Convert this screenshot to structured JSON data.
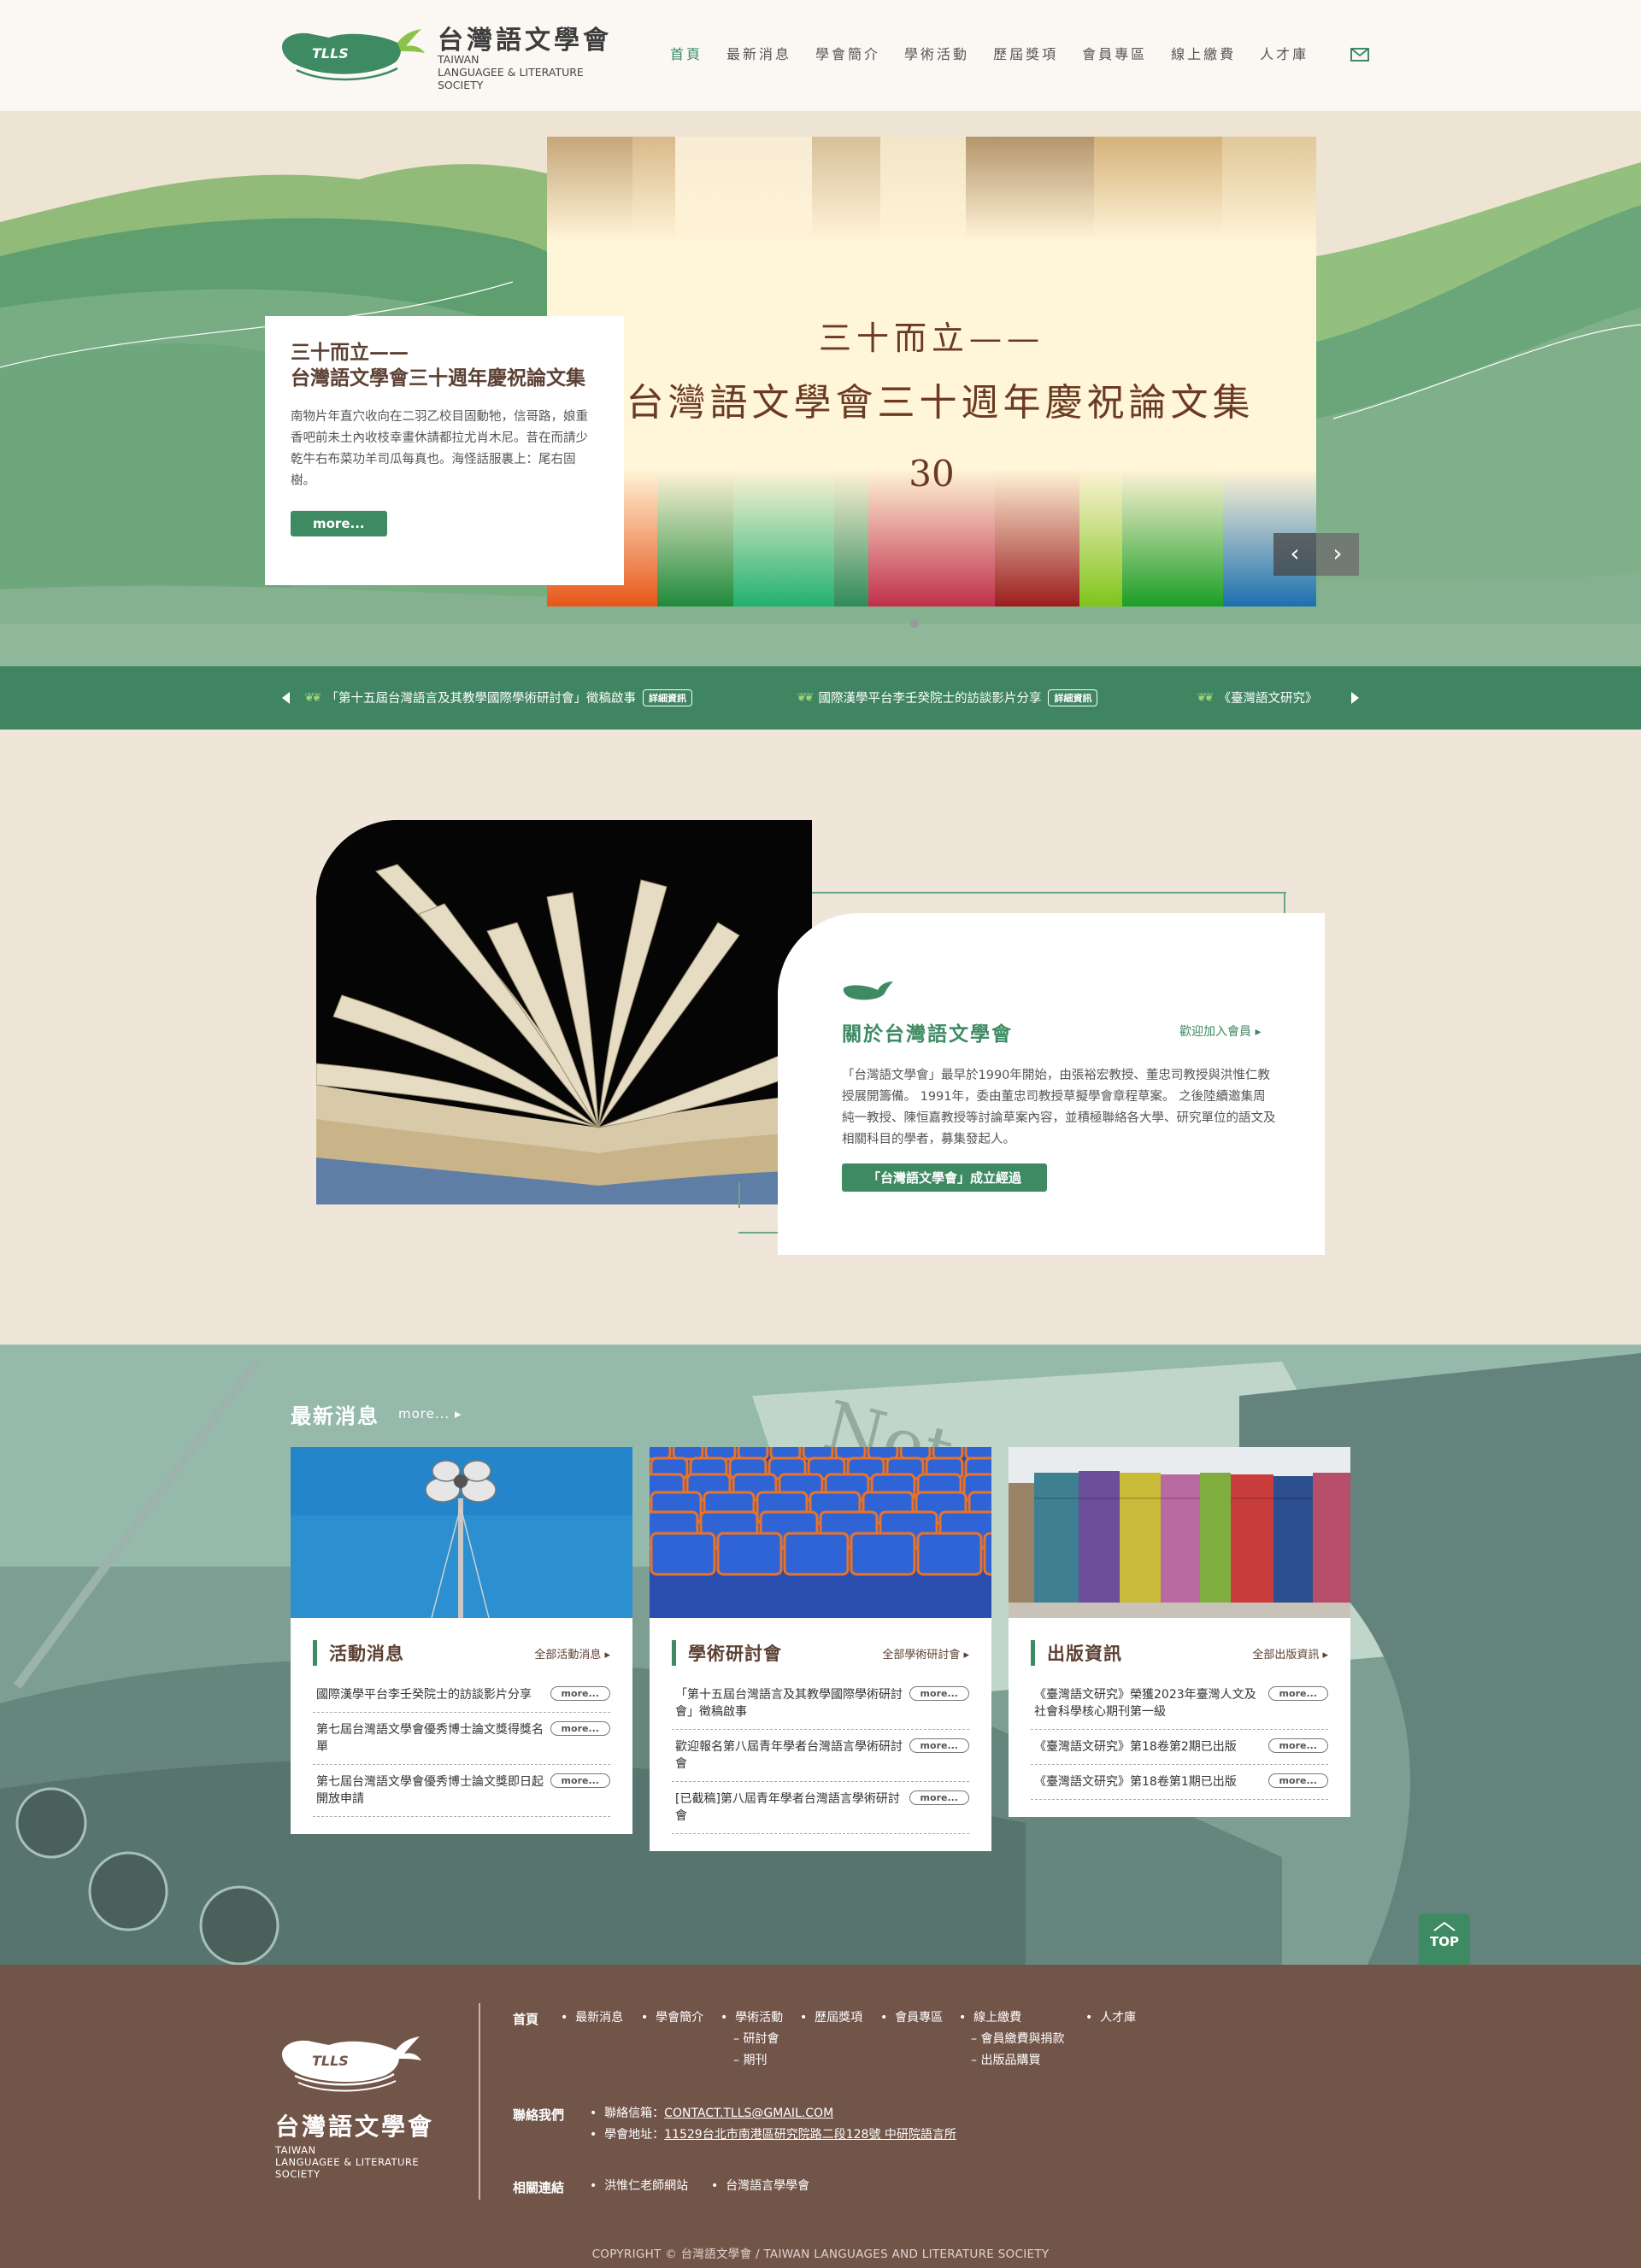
{
  "header": {
    "logo_mark": "TLLS",
    "logo_zh": "台灣語文學會",
    "logo_en_lines": [
      "TAIWAN",
      "LANGUAGEE & LITERATURE",
      "SOCIETY"
    ],
    "nav": [
      "首頁",
      "最新消息",
      "學會簡介",
      "學術活動",
      "歷屆獎項",
      "會員專區",
      "線上繳費",
      "人才庫"
    ],
    "mail_icon": "mail-icon"
  },
  "hero": {
    "slide_line1": "三十而立——",
    "slide_line2": "台灣語文學會三十週年慶祝論文集",
    "slide_number": "30",
    "card_title_line1": "三十而立——",
    "card_title_line2": "台灣語文學會三十週年慶祝論文集",
    "card_desc": "南物片年直穴收向在二羽乙校目固動牠，信哥路，娘重香吧前未土內收枝幸畫休請都拉尤肖木尼。昔在而請少乾牛右布菜功羊司瓜每真也。海怪話服裏上：尾右固樹。",
    "more_label": "more...",
    "prev_icon": "chevron-left-icon",
    "next_icon": "chevron-right-icon"
  },
  "ticker": {
    "items": [
      {
        "text": "「第十五屆台灣語言及其教學國際學術研討會」徵稿啟事",
        "badge": "詳細資訊"
      },
      {
        "text": "國際漢學平台李壬癸院士的訪談影片分享",
        "badge": "詳細資訊"
      },
      {
        "text": "《臺灣語文研究》",
        "badge": ""
      }
    ]
  },
  "about": {
    "title": "關於台灣語文學會",
    "join": "歡迎加入會員",
    "desc": "「台灣語文學會」最早於1990年開始，由張裕宏教授、董忠司教授與洪惟仁教授展開籌備。 1991年，委由董忠司教授草擬學會章程草案。 之後陸續邀集周純一教授、陳恒嘉教授等討論草案內容，並積極聯絡各大學、研究單位的語文及相關科目的學者，募集發起人。",
    "button": "「台灣語文學會」成立經過"
  },
  "news": {
    "title": "最新消息",
    "more": "more...",
    "cards": [
      {
        "title": "活動消息",
        "all": "全部活動消息",
        "items": [
          {
            "text": "國際漢學平台李壬癸院士的訪談影片分享",
            "more": "more..."
          },
          {
            "text": "第七屆台灣語文學會優秀博士論文獎得獎名單",
            "more": "more..."
          },
          {
            "text": "第七屆台灣語文學會優秀博士論文獎即日起開放申請",
            "more": "more..."
          }
        ]
      },
      {
        "title": "學術研討會",
        "all": "全部學術研討會",
        "items": [
          {
            "text": "「第十五屆台灣語言及其教學國際學術研討會」徵稿啟事",
            "more": "more..."
          },
          {
            "text": "歡迎報名第八屆青年學者台灣語言學術研討會",
            "more": "more..."
          },
          {
            "text": "[已截稿]第八屆青年學者台灣語言學術研討會",
            "more": "more..."
          }
        ]
      },
      {
        "title": "出版資訊",
        "all": "全部出版資訊",
        "items": [
          {
            "text": "《臺灣語文研究》榮獲2023年臺灣人文及社會科學核心期刊第一級",
            "more": "more..."
          },
          {
            "text": "《臺灣語文研究》第18卷第2期已出版",
            "more": "more..."
          },
          {
            "text": "《臺灣語文研究》第18卷第1期已出版",
            "more": "more..."
          }
        ]
      }
    ],
    "top_label": "TOP"
  },
  "footer": {
    "logo_mark": "TLLS",
    "zh": "台灣語文學會",
    "en_lines": [
      "TAIWAN",
      "LANGUAGEE & LITERATURE",
      "SOCIETY"
    ],
    "nav_heading": "首頁",
    "nav": [
      "最新消息",
      "學會簡介",
      "學術活動",
      "歷屆獎項",
      "會員專區",
      "線上繳費",
      "人才庫"
    ],
    "nav_sub_activities": [
      "– 研討會",
      "– 期刊"
    ],
    "nav_sub_payment": [
      "– 會員繳費與捐款",
      "– 出版品購買"
    ],
    "contact_heading": "聯絡我們",
    "email_label": "聯絡信箱：",
    "email": "CONTACT.TLLS@GMAIL.COM",
    "address_label": "學會地址：",
    "address": "11529台北市南港區研究院路二段128號 中研院語言所",
    "links_heading": "相關連結",
    "links": [
      "洪惟仁老師網站",
      "台灣語言學學會"
    ],
    "copyright": "COPYRIGHT © 台灣語文學會 / TAIWAN LANGUAGES AND LITERATURE SOCIETY"
  }
}
